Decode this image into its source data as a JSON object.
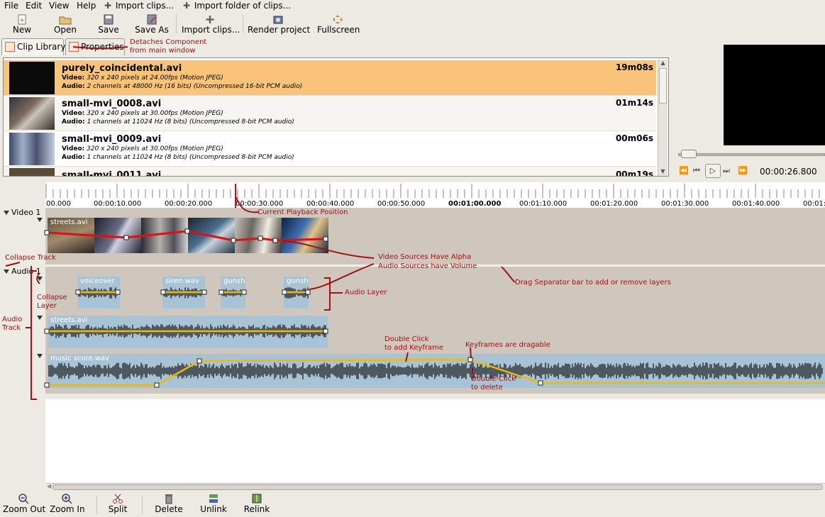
{
  "menu": {
    "file": "File",
    "edit": "Edit",
    "view": "View",
    "help": "Help",
    "import_clips": "Import clips...",
    "import_folder": "Import folder of clips..."
  },
  "toolbar": {
    "new": "New",
    "open": "Open",
    "save": "Save",
    "save_as": "Save As",
    "import_clips": "Import clips...",
    "render_project": "Render project",
    "fullscreen": "Fullscreen"
  },
  "tabs": {
    "clip_library": "Clip Library",
    "properties": "Properties"
  },
  "clips": [
    {
      "name": "purely_coincidental.avi",
      "video_label": "Video:",
      "video": "320 x 240 pixels at 24.00fps (Motion JPEG)",
      "audio_label": "Audio:",
      "audio": "2 channels at 48000 Hz (16 bits) (Uncompressed 16-bit PCM audio)",
      "duration": "19m08s"
    },
    {
      "name": "small-mvi_0008.avi",
      "video_label": "Video:",
      "video": "320 x 240 pixels at 30.00fps (Motion JPEG)",
      "audio_label": "Audio:",
      "audio": "1 channels at 11024 Hz (8 bits) (Uncompressed 8-bit PCM audio)",
      "duration": "01m14s"
    },
    {
      "name": "small-mvi_0009.avi",
      "video_label": "Video:",
      "video": "320 x 240 pixels at 30.00fps (Motion JPEG)",
      "audio_label": "Audio:",
      "audio": "1 channels at 11024 Hz (8 bits) (Uncompressed 8-bit PCM audio)",
      "duration": "00m06s"
    },
    {
      "name": "small-mvi_0011.avi",
      "duration": "00m19s"
    }
  ],
  "playback": {
    "timecode": "00:00:26.800",
    "position_fraction": 0.055
  },
  "ruler_ticks": [
    "00.000",
    "00:00:10.000",
    "00:00:20.000",
    "00:00:30.000",
    "00:00:40.000",
    "00:00:50.000",
    "00:01:00.000",
    "00:01:10.000",
    "00:01:20.000",
    "00:01:30.000",
    "00:01:40.000",
    "00:01:5"
  ],
  "tracks": {
    "video": "Video 1",
    "audio": "Audio 1"
  },
  "timeline_clips": {
    "video_streets": "streets.avi",
    "voiceover": "voiceover",
    "siren": "siren.wav",
    "gunsh1": "gunsh",
    "gunsh2": "gunsh",
    "audio_streets": "streets.avi",
    "music": "music score.wav"
  },
  "annotations": {
    "detach_1": "Detaches Component",
    "detach_2": "from main window",
    "playback_pos": "Current Playback Position",
    "collapse_track": "Collapse Track",
    "alpha_1": "Video Sources Have Alpha",
    "alpha_2": "Audio Sources have Volume",
    "drag_sep": "Drag Separator bar to add or remove layers",
    "audio_layer": "Audio Layer",
    "collapse_layer_1": "Collapse",
    "collapse_layer_2": "Layer",
    "audio_track_1": "Audio",
    "audio_track_2": "Track",
    "dbl_1": "Double Click",
    "dbl_2": "to add Keyframe",
    "kf_drag": "Keyframes are dragable",
    "del_1": "Double-Click",
    "del_2": "to delete"
  },
  "bottom_toolbar": {
    "zoom_out": "Zoom Out",
    "zoom_in": "Zoom In",
    "split": "Split",
    "delete": "Delete",
    "unlink": "Unlink",
    "relink": "Relink"
  },
  "colors": {
    "selection": "#f9c479",
    "annotation": "#a3120f",
    "audio_clip": "#a9c3d6",
    "volume_line": "#f5b800",
    "alpha_line": "#e01010",
    "playhead": "#cc1111"
  }
}
